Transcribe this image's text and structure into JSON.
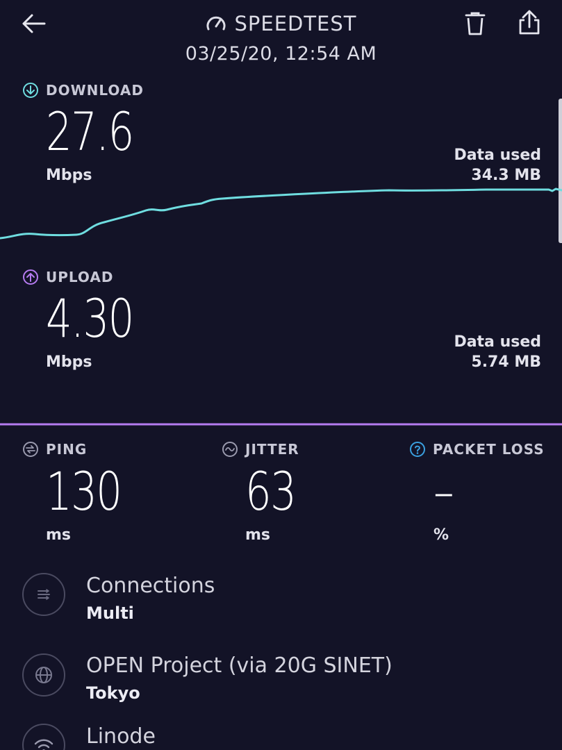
{
  "header": {
    "title": "SPEEDTEST",
    "timestamp": "03/25/20, 12:54 AM",
    "back_icon": "arrow-left-icon",
    "delete_icon": "trash-icon",
    "share_icon": "share-icon",
    "logo_icon": "speedometer-icon"
  },
  "download": {
    "label": "DOWNLOAD",
    "value": "27.6",
    "unit": "Mbps",
    "data_used_label": "Data used",
    "data_used_value": "34.3 MB",
    "color": "#6fdde0"
  },
  "upload": {
    "label": "UPLOAD",
    "value": "4.30",
    "unit": "Mbps",
    "data_used_label": "Data used",
    "data_used_value": "5.74 MB",
    "color": "#b57bf0"
  },
  "metrics": {
    "ping": {
      "label": "PING",
      "value": "130",
      "unit": "ms"
    },
    "jitter": {
      "label": "JITTER",
      "value": "63",
      "unit": "ms"
    },
    "packet_loss": {
      "label": "PACKET LOSS",
      "value": "–",
      "unit": "%"
    }
  },
  "info": {
    "connections": {
      "title": "Connections",
      "value": "Multi"
    },
    "server": {
      "title": "OPEN Project (via 20G SINET)",
      "location": "Tokyo"
    },
    "isp": {
      "title": "Linode"
    }
  },
  "colors": {
    "background": "#131327",
    "accent_download": "#6fdde0",
    "accent_upload": "#b57bf0",
    "help_icon": "#3aa0e0"
  }
}
